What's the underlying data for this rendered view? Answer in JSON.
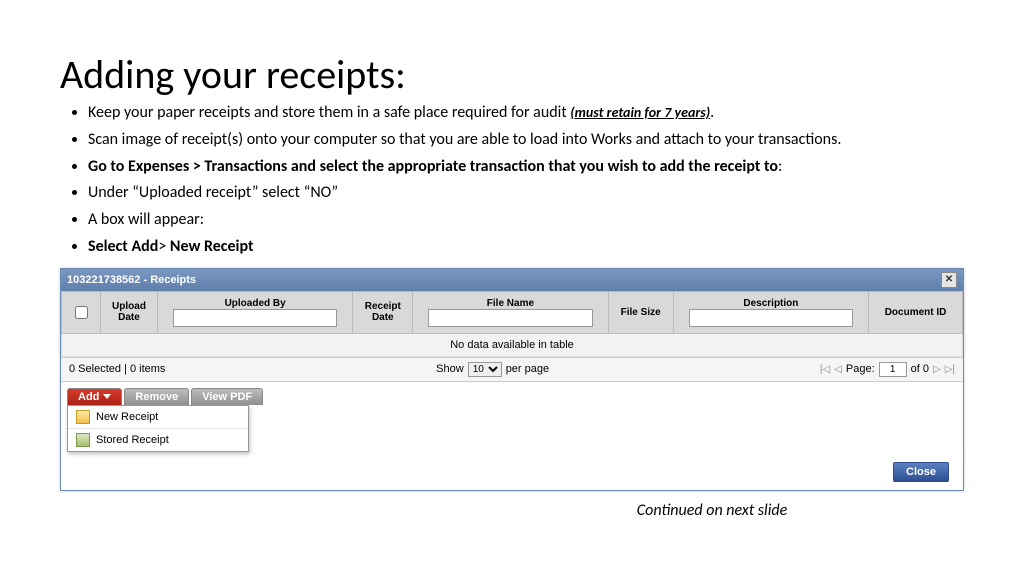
{
  "title": "Adding your receipts:",
  "bullets": {
    "b1_a": "Keep your paper receipts and store them in a safe place required for audit ",
    "b1_b": "(must retain for 7 years)",
    "b1_c": ".",
    "b2": "Scan image of receipt(s) onto your computer so  that you are able to load into Works and attach to your transactions.",
    "b3": "Go to Expenses > Transactions and select the appropriate transaction that you wish to add the receipt to",
    "b3_colon": ":",
    "b4": "Under “Uploaded receipt” select “NO”",
    "b5": "A box will appear:",
    "b6_a": "Select Add",
    "b6_b": "> ",
    "b6_c": "New Receipt"
  },
  "panel": {
    "header_title": "103221738562 - Receipts",
    "close_x": "✕",
    "columns": {
      "upload_date": "Upload\nDate",
      "uploaded_by": "Uploaded By",
      "receipt_date": "Receipt\nDate",
      "file_name": "File Name",
      "file_size": "File Size",
      "description": "Description",
      "document_id": "Document ID"
    },
    "no_data": "No data available in table",
    "footer": {
      "selected": "0 Selected  | 0 items",
      "show": "Show",
      "per_page_value": "10",
      "per_page_label": "per page",
      "page_label": "Page:",
      "page_num": "1",
      "of_label": "of 0"
    },
    "actions": {
      "add": "Add",
      "remove": "Remove",
      "view_pdf": "View PDF",
      "menu_new": "New Receipt",
      "menu_stored": "Stored Receipt"
    },
    "close_btn": "Close"
  },
  "continued": "Continued on next slide"
}
